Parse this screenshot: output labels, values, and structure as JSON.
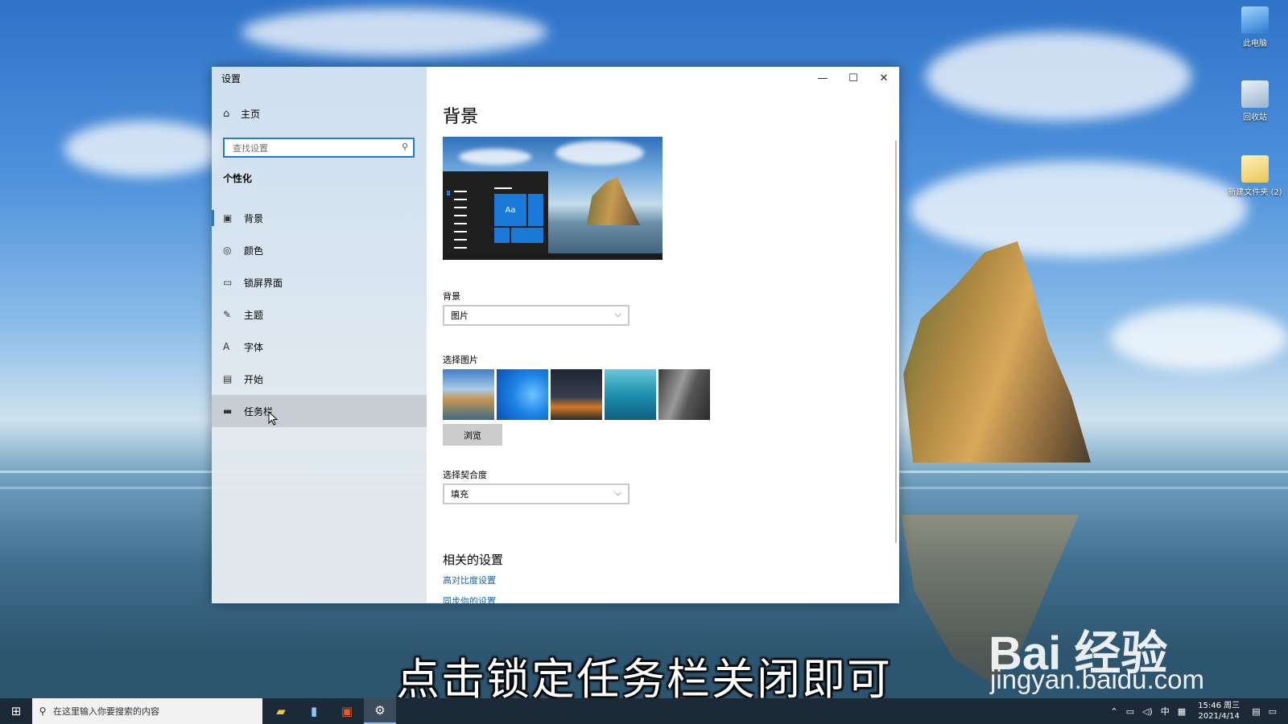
{
  "desktop": {
    "icons": [
      {
        "label": "此电脑",
        "icon": "computer-icon"
      },
      {
        "label": "回收站",
        "icon": "recycle-bin-icon"
      },
      {
        "label": "新建文件夹 (2)",
        "icon": "folder-icon"
      }
    ],
    "subtitle": "点击锁定任务栏关闭即可",
    "watermark": {
      "brand": "Bai 经验",
      "url": "jingyan.baidu.com"
    }
  },
  "window": {
    "title": "设置",
    "controls": {
      "minimize": "—",
      "maximize": "☐",
      "close": "✕"
    }
  },
  "sidebar": {
    "home_label": "主页",
    "search_placeholder": "查找设置",
    "section_title": "个性化",
    "items": [
      {
        "label": "背景",
        "icon": "picture-icon",
        "glyph": "▣"
      },
      {
        "label": "颜色",
        "icon": "palette-icon",
        "glyph": "◎"
      },
      {
        "label": "锁屏界面",
        "icon": "lock-screen-icon",
        "glyph": "▭"
      },
      {
        "label": "主题",
        "icon": "theme-icon",
        "glyph": "✎"
      },
      {
        "label": "字体",
        "icon": "font-icon",
        "glyph": "A"
      },
      {
        "label": "开始",
        "icon": "start-icon",
        "glyph": "▤"
      },
      {
        "label": "任务栏",
        "icon": "taskbar-icon",
        "glyph": "▬"
      }
    ]
  },
  "main": {
    "title": "背景",
    "preview_tile_text": "Aa",
    "background_label": "背景",
    "background_value": "图片",
    "choose_picture_label": "选择图片",
    "browse_label": "浏览",
    "fit_label": "选择契合度",
    "fit_value": "填充",
    "related_title": "相关的设置",
    "links": [
      "高对比度设置",
      "同步你的设置"
    ]
  },
  "taskbar": {
    "search_placeholder": "在这里输入你要搜索的内容",
    "apps": [
      "file-explorer-icon",
      "notepad-icon",
      "office-icon",
      "settings-icon"
    ],
    "tray": {
      "ime": "中",
      "time": "15:46 周三",
      "date": "2021/4/14"
    }
  },
  "colors": {
    "accent": "#1d7cd7",
    "link": "#0a66b5",
    "taskbar": "#1c2a38"
  }
}
